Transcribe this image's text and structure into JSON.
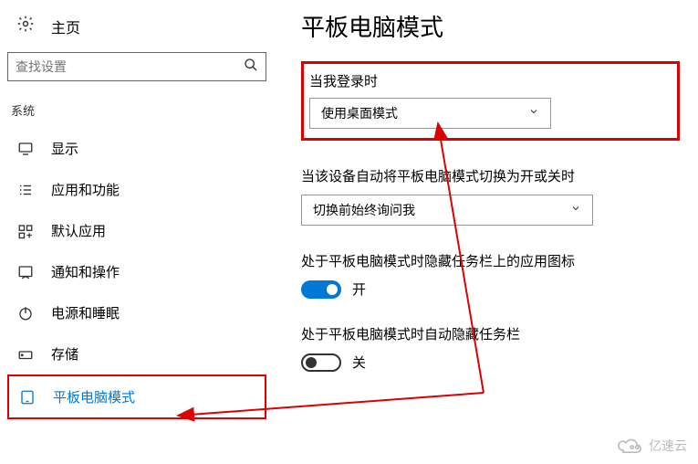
{
  "sidebar": {
    "home_label": "主页",
    "search_placeholder": "查找设置",
    "section_label": "系统",
    "items": [
      {
        "label": "显示"
      },
      {
        "label": "应用和功能"
      },
      {
        "label": "默认应用"
      },
      {
        "label": "通知和操作"
      },
      {
        "label": "电源和睡眠"
      },
      {
        "label": "存储"
      },
      {
        "label": "平板电脑模式"
      }
    ]
  },
  "main": {
    "title": "平板电脑模式",
    "login_label": "当我登录时",
    "login_selected": "使用桌面模式",
    "auto_switch_label": "当该设备自动将平板电脑模式切换为开或关时",
    "auto_switch_selected": "切换前始终询问我",
    "hide_icons_label": "处于平板电脑模式时隐藏任务栏上的应用图标",
    "hide_icons_state": "开",
    "auto_hide_label": "处于平板电脑模式时自动隐藏任务栏",
    "auto_hide_state": "关"
  },
  "watermark": "亿速云"
}
